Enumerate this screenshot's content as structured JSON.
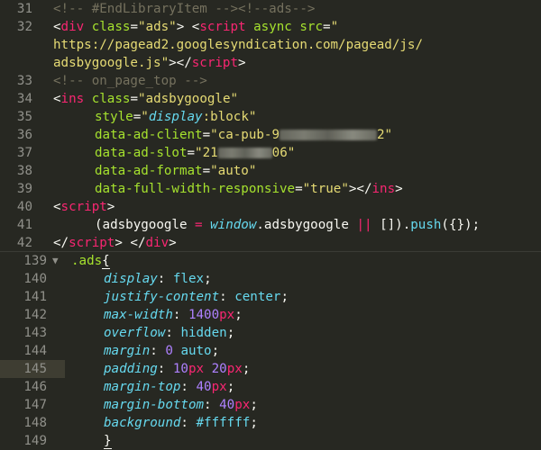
{
  "top_pane": {
    "lines": [
      {
        "num": "31",
        "parts": [
          "<!-- #EndLibraryItem --><!--ads-->"
        ]
      },
      {
        "num": "32",
        "parts": [
          "<",
          "div",
          " ",
          "class",
          "=",
          "\"ads\"",
          "> <",
          "script",
          " ",
          "async",
          " ",
          "src",
          "=",
          "\""
        ]
      },
      {
        "num": "",
        "parts": [
          "https://pagead2.googlesyndication.com/pagead/js/"
        ]
      },
      {
        "num": "",
        "parts": [
          "adsbygoogle.js\"",
          "></",
          "script",
          ">"
        ]
      },
      {
        "num": "33",
        "parts": [
          "<!-- on_page_top -->"
        ]
      },
      {
        "num": "34",
        "parts": [
          "<",
          "ins",
          " ",
          "class",
          "=",
          "\"adsbygoogle\""
        ]
      },
      {
        "num": "35",
        "parts": [
          "style",
          "=",
          "\"",
          "display",
          ":block\""
        ]
      },
      {
        "num": "36",
        "parts": [
          "data-ad-client",
          "=",
          "\"ca-pub-9",
          "2\""
        ]
      },
      {
        "num": "37",
        "parts": [
          "data-ad-slot",
          "=",
          "\"21",
          "06\""
        ]
      },
      {
        "num": "38",
        "parts": [
          "data-ad-format",
          "=",
          "\"auto\""
        ]
      },
      {
        "num": "39",
        "parts": [
          "data-full-width-responsive",
          "=",
          "\"true\"",
          "></",
          "ins",
          ">"
        ]
      },
      {
        "num": "40",
        "parts": [
          "<",
          "script",
          ">"
        ]
      },
      {
        "num": "41",
        "parts": [
          "(adsbygoogle ",
          "=",
          " ",
          "window",
          ".adsbygoogle ",
          "||",
          " []).",
          "push",
          "({});"
        ]
      },
      {
        "num": "42",
        "parts": [
          "</",
          "script",
          "> </",
          "div",
          ">"
        ]
      }
    ]
  },
  "bottom_pane": {
    "lines": [
      {
        "num": "139",
        "fold": "▼",
        "parts": [
          ".ads",
          "{"
        ]
      },
      {
        "num": "140",
        "parts": [
          "display",
          ": ",
          "flex",
          ";"
        ]
      },
      {
        "num": "141",
        "parts": [
          "justify-content",
          ": ",
          "center",
          ";"
        ]
      },
      {
        "num": "142",
        "parts": [
          "max-width",
          ": ",
          "1400",
          "px",
          ";"
        ]
      },
      {
        "num": "143",
        "parts": [
          "overflow",
          ": ",
          "hidden",
          ";"
        ]
      },
      {
        "num": "144",
        "parts": [
          "margin",
          ": ",
          "0",
          " ",
          "auto",
          ";"
        ]
      },
      {
        "num": "145",
        "parts": [
          "padding",
          ": ",
          "10",
          "px",
          " ",
          "20",
          "px",
          ";"
        ]
      },
      {
        "num": "146",
        "parts": [
          "margin-top",
          ": ",
          "40",
          "px",
          ";"
        ]
      },
      {
        "num": "147",
        "parts": [
          "margin-bottom",
          ": ",
          "40",
          "px",
          ";"
        ]
      },
      {
        "num": "148",
        "parts": [
          "background",
          ": ",
          "#ffffff",
          ";"
        ]
      },
      {
        "num": "149",
        "parts": [
          "}"
        ]
      }
    ]
  },
  "theme": {
    "background": "#272822",
    "tag": "#f92672",
    "attribute": "#a6e22e",
    "string": "#e6db74",
    "comment": "#75715e",
    "keyword_italic": "#66d9ef",
    "number": "#ae81ff",
    "gutter": "#90908a"
  },
  "icons": {
    "fold": "fold-arrow-icon"
  }
}
